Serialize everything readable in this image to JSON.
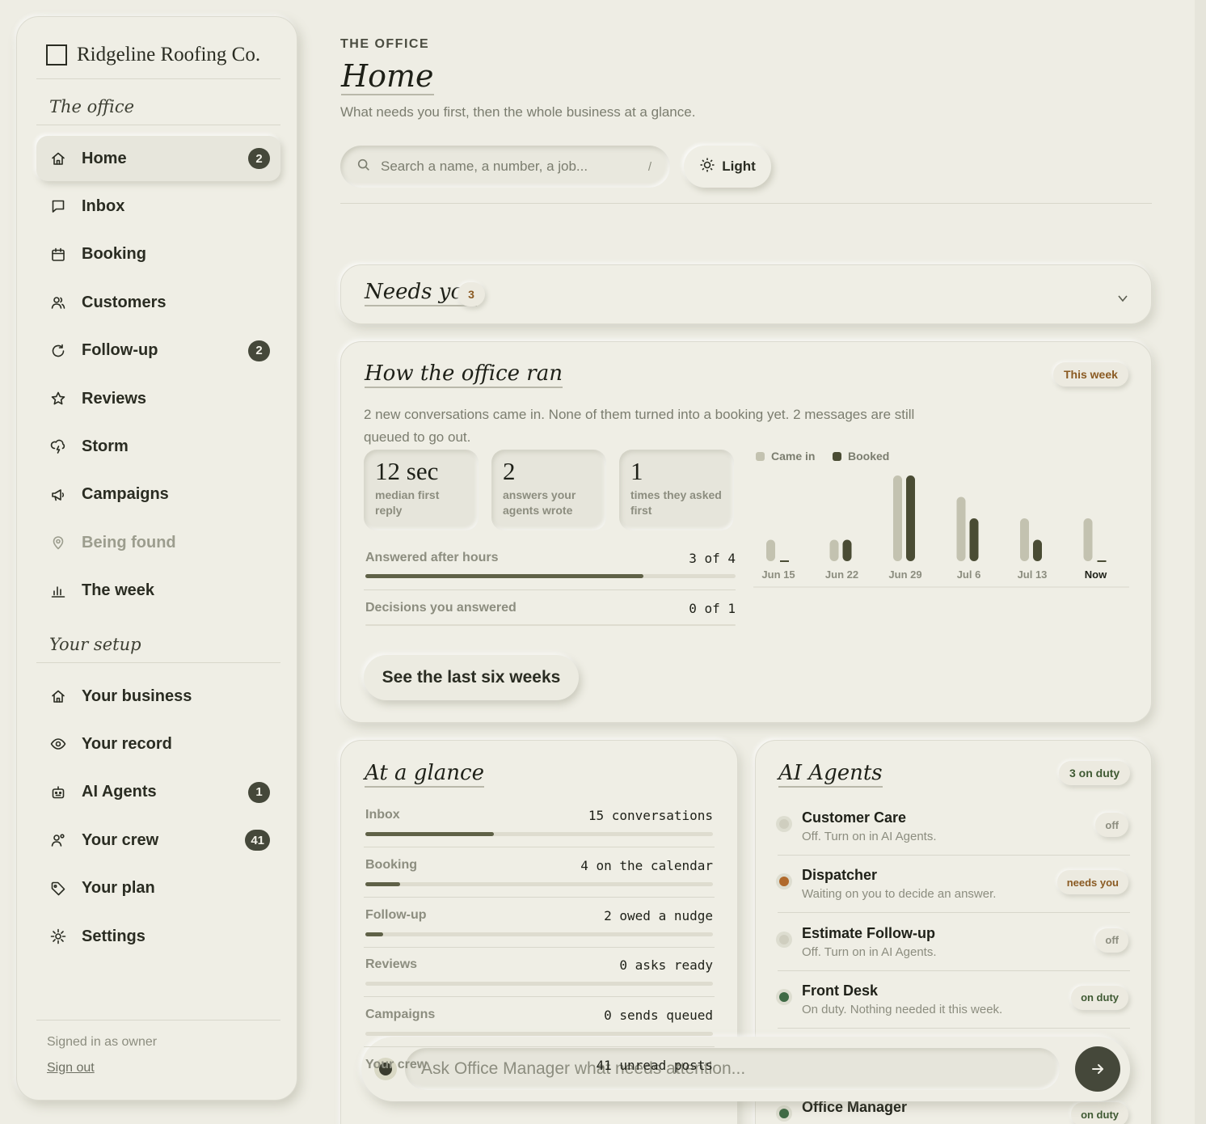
{
  "brand": {
    "name": "Ridgeline Roofing Co."
  },
  "sidebar": {
    "section_office": "The office",
    "section_setup": "Your setup",
    "office_items": [
      {
        "label": "Home",
        "icon": "home-icon",
        "badge": "2",
        "active": true
      },
      {
        "label": "Inbox",
        "icon": "message-icon",
        "badge": ""
      },
      {
        "label": "Booking",
        "icon": "calendar-icon",
        "badge": ""
      },
      {
        "label": "Customers",
        "icon": "users-icon",
        "badge": ""
      },
      {
        "label": "Follow-up",
        "icon": "refresh-icon",
        "badge": "2"
      },
      {
        "label": "Reviews",
        "icon": "star-icon",
        "badge": ""
      },
      {
        "label": "Storm",
        "icon": "storm-icon",
        "badge": ""
      },
      {
        "label": "Campaigns",
        "icon": "megaphone-icon",
        "badge": ""
      },
      {
        "label": "Being found",
        "icon": "map-pin-icon",
        "badge": "",
        "muted": true
      },
      {
        "label": "The week",
        "icon": "bar-chart-icon",
        "badge": ""
      }
    ],
    "setup_items": [
      {
        "label": "Your business",
        "icon": "home-icon",
        "badge": ""
      },
      {
        "label": "Your record",
        "icon": "eye-icon",
        "badge": ""
      },
      {
        "label": "AI Agents",
        "icon": "robot-icon",
        "badge": "1"
      },
      {
        "label": "Your crew",
        "icon": "user-plus-icon",
        "badge": "41"
      },
      {
        "label": "Your plan",
        "icon": "tag-icon",
        "badge": ""
      },
      {
        "label": "Settings",
        "icon": "gear-icon",
        "badge": ""
      }
    ],
    "signed_in": "Signed in as owner",
    "sign_out": "Sign out"
  },
  "header": {
    "eyebrow": "THE OFFICE",
    "title": "Home",
    "subtitle": "What needs you first, then the whole business at a glance.",
    "search_placeholder": "Search a name, a number, a job...",
    "search_shortcut": "/",
    "theme_label": "Light"
  },
  "needs_you": {
    "title": "Needs you",
    "count": "3"
  },
  "office_ran": {
    "title": "How the office ran",
    "period": "This week",
    "summary": "2 new conversations came in. None of them turned into a booking yet. 2 messages are still queued to go out.",
    "stats": [
      {
        "value": "12 sec",
        "label": "median first reply"
      },
      {
        "value": "2",
        "label": "answers your agents wrote"
      },
      {
        "value": "1",
        "label": "times they asked first"
      }
    ],
    "meters": [
      {
        "label": "Answered after hours",
        "value": "3 of 4",
        "fraction": 0.75
      },
      {
        "label": "Decisions you answered",
        "value": "0 of 1",
        "fraction": 0
      }
    ],
    "button": "See the last six weeks"
  },
  "chart_data": {
    "type": "bar",
    "categories": [
      "Jun 15",
      "Jun 22",
      "Jun 29",
      "Jul 6",
      "Jul 13",
      "Now"
    ],
    "series": [
      {
        "name": "Came in",
        "values": [
          2,
          2,
          8,
          6,
          4,
          4
        ],
        "color": "#c3c2b0"
      },
      {
        "name": "Booked",
        "values": [
          0,
          2,
          8,
          4,
          2,
          0
        ],
        "color": "#4a4c34"
      }
    ],
    "ylim": [
      0,
      8
    ],
    "legend": "top-left",
    "grid": false
  },
  "glance": {
    "title": "At a glance",
    "rows": [
      {
        "label": "Inbox",
        "value": "15 conversations",
        "fraction": 0.37
      },
      {
        "label": "Booking",
        "value": "4 on the calendar",
        "fraction": 0.1
      },
      {
        "label": "Follow-up",
        "value": "2 owed a nudge",
        "fraction": 0.05
      },
      {
        "label": "Reviews",
        "value": "0 asks ready",
        "fraction": 0
      },
      {
        "label": "Campaigns",
        "value": "0 sends queued",
        "fraction": 0
      },
      {
        "label": "Your crew",
        "value": "41 unread posts",
        "fraction": 1
      }
    ]
  },
  "agents": {
    "title": "AI Agents",
    "on_duty": "3 on duty",
    "items": [
      {
        "name": "Customer Care",
        "desc": "Off. Turn on in AI Agents.",
        "status": "off",
        "dot": "#cfcebf",
        "pill_color": "#8c8d7f"
      },
      {
        "name": "Dispatcher",
        "desc": "Waiting on you to decide an answer.",
        "status": "needs you",
        "dot": "#b0692b",
        "pill_color": "#8a5a22"
      },
      {
        "name": "Estimate Follow-up",
        "desc": "Off. Turn on in AI Agents.",
        "status": "off",
        "dot": "#cfcebf",
        "pill_color": "#8c8d7f"
      },
      {
        "name": "Front Desk",
        "desc": "On duty. Nothing needed it this week.",
        "status": "on duty",
        "dot": "#3f6a45",
        "pill_color": "#3f5a33"
      },
      {
        "name": "Office Manager",
        "desc": "",
        "status": "on duty",
        "dot": "#3f6a45",
        "pill_color": "#3f5a33"
      }
    ]
  },
  "chat": {
    "placeholder": "Ask Office Manager what needs attention..."
  },
  "colors": {
    "accent": "#45483a",
    "warning": "#8a5a22",
    "ok": "#3f5a33"
  }
}
